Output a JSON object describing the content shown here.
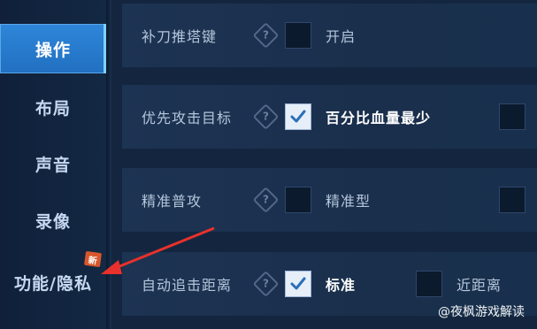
{
  "sidebar": {
    "items": [
      {
        "label": "操作",
        "active": true
      },
      {
        "label": "布局",
        "active": false
      },
      {
        "label": "声音",
        "active": false
      },
      {
        "label": "录像",
        "active": false
      },
      {
        "label": "功能/隐私",
        "active": false
      }
    ],
    "new_badge": "新"
  },
  "settings": {
    "rows": [
      {
        "label": "补刀推塔键",
        "option1": {
          "checked": false,
          "label": "开启"
        }
      },
      {
        "label": "优先攻击目标",
        "option1": {
          "checked": true,
          "label": "百分比血量最少"
        },
        "option2": {
          "checked": false
        }
      },
      {
        "label": "精准普攻",
        "option1": {
          "checked": false,
          "label": "精准型"
        },
        "option2": {
          "checked": false
        }
      },
      {
        "label": "自动追击距离",
        "option1": {
          "checked": true,
          "label": "标准"
        },
        "option2": {
          "checked": false,
          "label": "近距离"
        }
      }
    ]
  },
  "watermark": {
    "text": "@夜枫游戏解读"
  },
  "annotation": {
    "arrow_color": "#e8312c"
  },
  "colors": {
    "accent": "#2f86d9",
    "background": "#14263f"
  }
}
